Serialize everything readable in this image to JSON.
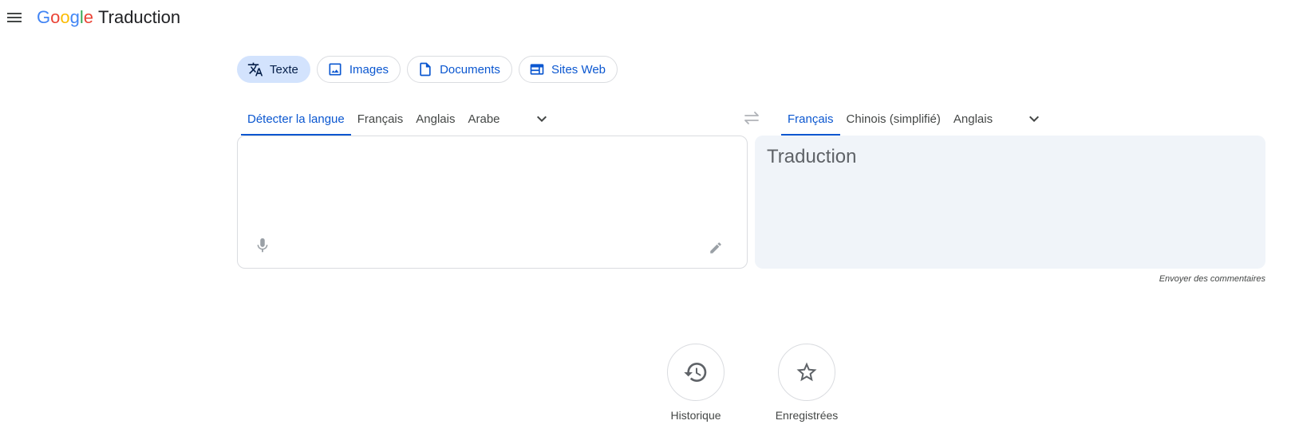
{
  "header": {
    "menu_icon": "menu-icon",
    "logo_text": "Google",
    "product_name": "Traduction",
    "logo_colors": [
      "#4285F4",
      "#EA4335",
      "#FBBC05",
      "#4285F4",
      "#34A853",
      "#EA4335"
    ]
  },
  "modes": [
    {
      "label": "Texte",
      "icon": "translate-icon",
      "active": true
    },
    {
      "label": "Images",
      "icon": "image-icon",
      "active": false
    },
    {
      "label": "Documents",
      "icon": "document-icon",
      "active": false
    },
    {
      "label": "Sites Web",
      "icon": "website-icon",
      "active": false
    }
  ],
  "source_langs": [
    "Détecter la langue",
    "Français",
    "Anglais",
    "Arabe"
  ],
  "source_selected": "Détecter la langue",
  "target_langs": [
    "Français",
    "Chinois (simplifié)",
    "Anglais"
  ],
  "target_selected": "Français",
  "source_panel": {
    "value": "",
    "mic_icon": "microphone-icon",
    "edit_icon": "pencil-icon"
  },
  "target_panel": {
    "placeholder": "Traduction"
  },
  "feedback": "Envoyer des commentaires",
  "actions": [
    {
      "label": "Historique",
      "icon": "history-icon"
    },
    {
      "label": "Enregistrées",
      "icon": "star-icon"
    }
  ],
  "colors": {
    "accent": "#0b57d0",
    "active_chip_bg": "#d3e3fd",
    "target_bg": "#f0f4f9"
  }
}
